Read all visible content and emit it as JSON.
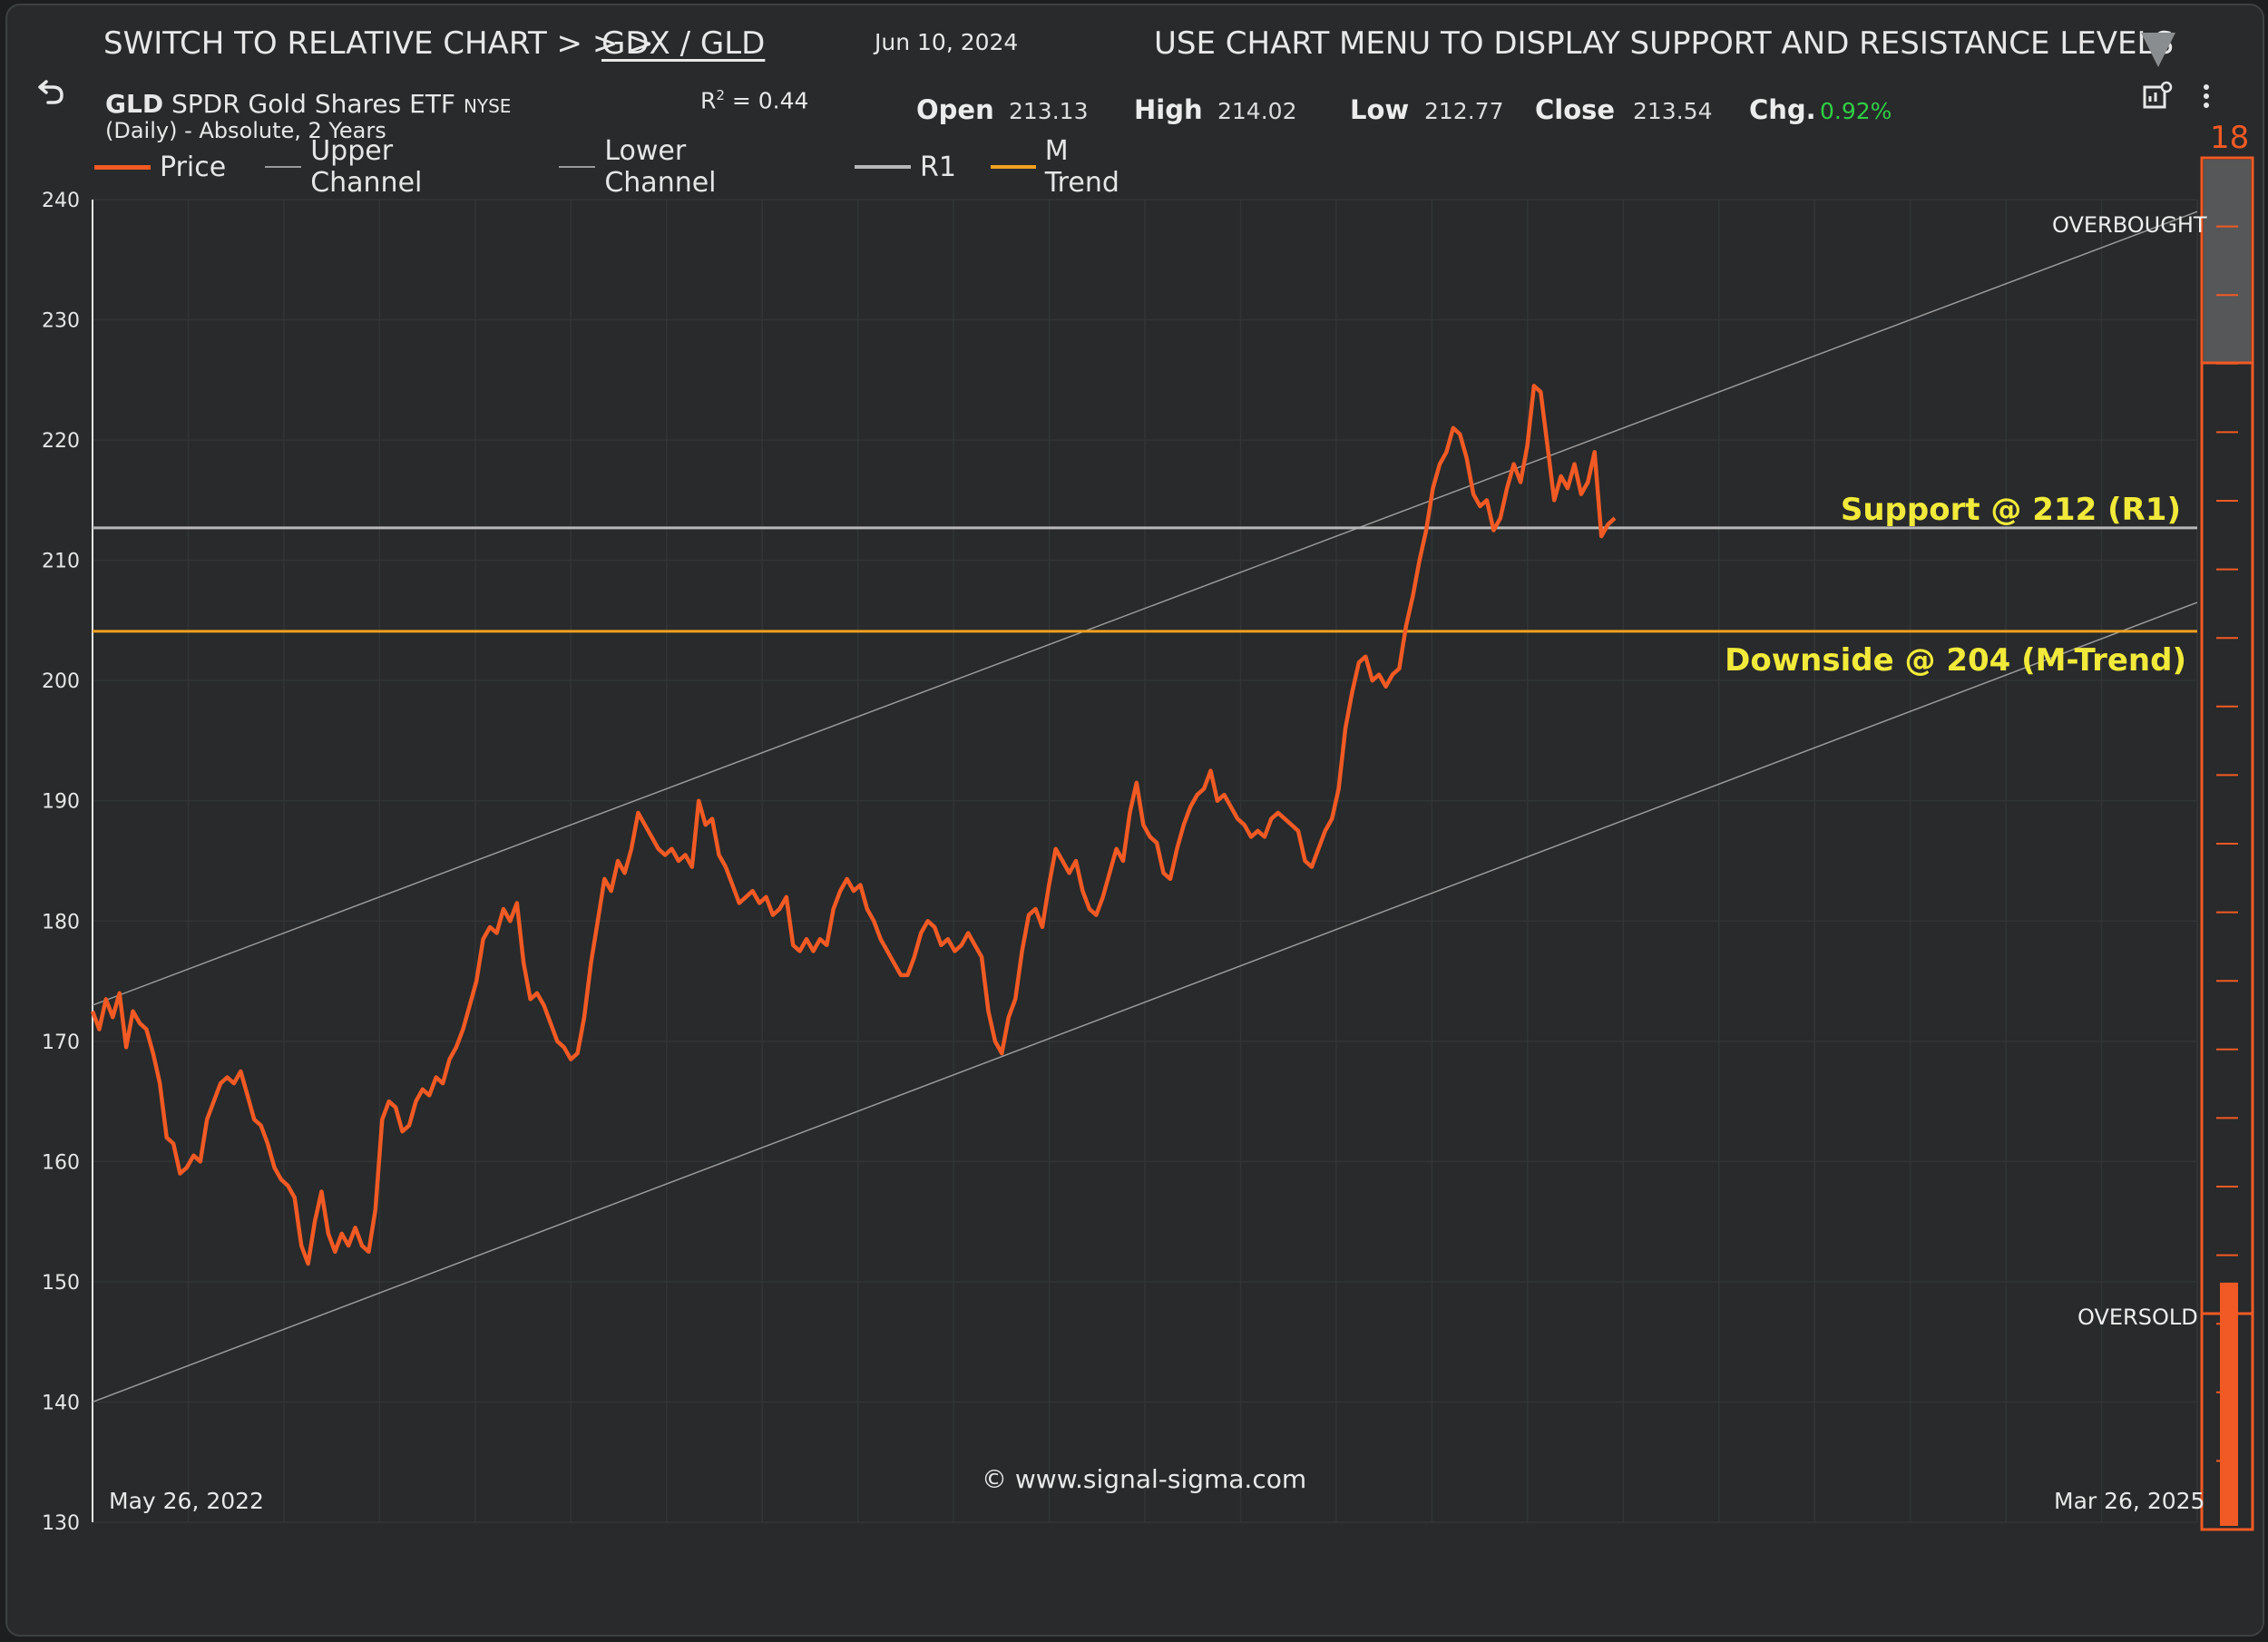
{
  "header": {
    "switch_text": "SWITCH TO RELATIVE CHART > > >",
    "pair_link": "GDX / GLD",
    "date": "Jun 10, 2024",
    "menu_hint": "USE CHART MENU TO DISPLAY SUPPORT AND RESISTANCE LEVELS",
    "ticker_symbol": "GLD",
    "ticker_name": "SPDR Gold Shares ETF",
    "exchange": "NYSE",
    "subtitle": "(Daily) - Absolute, 2 Years",
    "r2_label": "R",
    "r2_sup": "2",
    "r2_value": "=  0.44"
  },
  "quote": {
    "open_label": "Open",
    "open_value": "213.13",
    "high_label": "High",
    "high_value": "214.02",
    "low_label": "Low",
    "low_value": "212.77",
    "close_label": "Close",
    "close_value": "213.54",
    "chg_label": "Chg.",
    "chg_value": "0.92%"
  },
  "legend": {
    "items": [
      {
        "label": "Price",
        "color": "#f15a24"
      },
      {
        "label": "Upper Channel",
        "color": "#9a9a9a"
      },
      {
        "label": "Lower Channel",
        "color": "#9a9a9a"
      },
      {
        "label": "R1",
        "color": "#b8b8b8"
      },
      {
        "label": "M Trend",
        "color": "#f0a020"
      }
    ]
  },
  "annotations": {
    "support": "Support @ 212 (R1)",
    "downside": "Downside @ 204 (M-Trend)",
    "copyright": "© www.signal-sigma.com",
    "date_start": "May 26, 2022",
    "date_end": "Mar 26, 2025"
  },
  "signal_gauge": {
    "value": "18",
    "value_numeric": 18,
    "max": 100,
    "overbought_label": "OVERBOUGHT",
    "oversold_label": "OVERSOLD",
    "color": "#f15a24"
  },
  "icons": {
    "undo": "undo-icon",
    "settings": "chart-settings-icon",
    "menu": "kebab-menu-icon",
    "arrow": "triangle-down-icon"
  },
  "chart_data": {
    "type": "line",
    "title": "",
    "xlabel": "",
    "ylabel": "",
    "x_start": "May 26, 2022",
    "x_end": "Mar 26, 2025",
    "ylim": [
      130,
      240
    ],
    "yticks": [
      240,
      230,
      220,
      210,
      200,
      190,
      180,
      170,
      160,
      150,
      140,
      130
    ],
    "grid": true,
    "legend_position": "top-left",
    "series": [
      {
        "name": "Price",
        "color": "#f15a24",
        "values": [
          172.5,
          171.0,
          173.5,
          172.0,
          174.0,
          169.5,
          172.5,
          171.5,
          171.0,
          169.0,
          166.5,
          162.0,
          161.5,
          159.0,
          159.5,
          160.5,
          160.0,
          163.5,
          165.0,
          166.5,
          167.0,
          166.5,
          167.5,
          165.5,
          163.5,
          163.0,
          161.5,
          159.5,
          158.5,
          158.0,
          157.0,
          153.0,
          151.5,
          155.0,
          157.5,
          154.0,
          152.5,
          154.0,
          153.0,
          154.5,
          153.0,
          152.5,
          156.0,
          163.5,
          165.0,
          164.5,
          162.5,
          163.0,
          165.0,
          166.0,
          165.5,
          167.0,
          166.5,
          168.5,
          169.5,
          171.0,
          173.0,
          175.0,
          178.5,
          179.5,
          179.0,
          181.0,
          180.0,
          181.5,
          176.5,
          173.5,
          174.0,
          173.0,
          171.5,
          170.0,
          169.5,
          168.5,
          169.0,
          172.0,
          176.5,
          180.0,
          183.5,
          182.5,
          185.0,
          184.0,
          186.0,
          189.0,
          188.0,
          187.0,
          186.0,
          185.5,
          186.0,
          185.0,
          185.5,
          184.5,
          190.0,
          188.0,
          188.5,
          185.5,
          184.5,
          183.0,
          181.5,
          182.0,
          182.5,
          181.5,
          182.0,
          180.5,
          181.0,
          182.0,
          178.0,
          177.5,
          178.5,
          177.5,
          178.5,
          178.0,
          181.0,
          182.5,
          183.5,
          182.5,
          183.0,
          181.0,
          180.0,
          178.5,
          177.5,
          176.5,
          175.5,
          175.5,
          177.0,
          179.0,
          180.0,
          179.5,
          178.0,
          178.5,
          177.5,
          178.0,
          179.0,
          178.0,
          177.0,
          172.5,
          170.0,
          169.0,
          172.0,
          173.5,
          177.5,
          180.5,
          181.0,
          179.5,
          183.0,
          186.0,
          185.0,
          184.0,
          185.0,
          182.5,
          181.0,
          180.5,
          182.0,
          184.0,
          186.0,
          185.0,
          189.0,
          191.5,
          188.0,
          187.0,
          186.5,
          184.0,
          183.5,
          186.0,
          188.0,
          189.5,
          190.5,
          191.0,
          192.5,
          190.0,
          190.5,
          189.5,
          188.5,
          188.0,
          187.0,
          187.5,
          187.0,
          188.5,
          189.0,
          188.5,
          188.0,
          187.5,
          185.0,
          184.5,
          186.0,
          187.5,
          188.5,
          191.0,
          196.0,
          199.0,
          201.5,
          202.0,
          200.0,
          200.5,
          199.5,
          200.5,
          201.0,
          204.5,
          207.0,
          210.0,
          212.5,
          216.0,
          218.0,
          219.0,
          221.0,
          220.5,
          218.5,
          215.5,
          214.5,
          215.0,
          212.5,
          213.5,
          216.0,
          218.0,
          216.5,
          219.5,
          224.5,
          224.0,
          219.5,
          215.0,
          217.0,
          216.0,
          218.0,
          215.5,
          216.5,
          219.0,
          212.0,
          213.0,
          213.5
        ]
      }
    ],
    "channels": {
      "upper": {
        "name": "Upper Channel",
        "start": 173.0,
        "end": 239.0
      },
      "lower": {
        "name": "Lower Channel",
        "start": 140.0,
        "end": 206.5
      }
    },
    "levels": [
      {
        "name": "R1",
        "value": 212.7,
        "color": "#b8b8b8"
      },
      {
        "name": "M Trend",
        "value": 204.1,
        "color": "#f0a020"
      }
    ]
  }
}
